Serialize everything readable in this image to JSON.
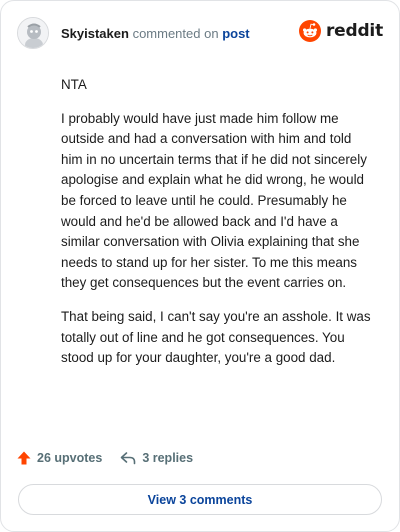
{
  "header": {
    "username": "Skyistaken",
    "action": "commented on",
    "target": "post",
    "brand": "reddit"
  },
  "comment": {
    "paragraphs": [
      "NTA",
      "I probably would have just made him follow me outside and had a conversation with him and told him in no uncertain terms that if he did not sincerely apologise and explain what he did wrong, he would be forced to leave until he could. Presumably he would and he'd be allowed back and I'd have a similar conversation with Olivia explaining that she needs to stand up for her sister. To me this means they get consequences but the event carries on.",
      "That being said, I can't say you're an asshole. It was totally out of line and he got consequences. You stood up for your daughter, you're a good dad."
    ]
  },
  "footer": {
    "upvotes": "26 upvotes",
    "replies": "3 replies",
    "view_button": "View 3 comments"
  },
  "colors": {
    "brand": "#ff4500",
    "link": "#0a449b",
    "muted": "#576f76"
  },
  "icons": {
    "avatar": "avatar-icon",
    "logo": "reddit-logo-icon",
    "upvote": "upvote-arrow-icon",
    "reply": "reply-arrow-icon"
  }
}
